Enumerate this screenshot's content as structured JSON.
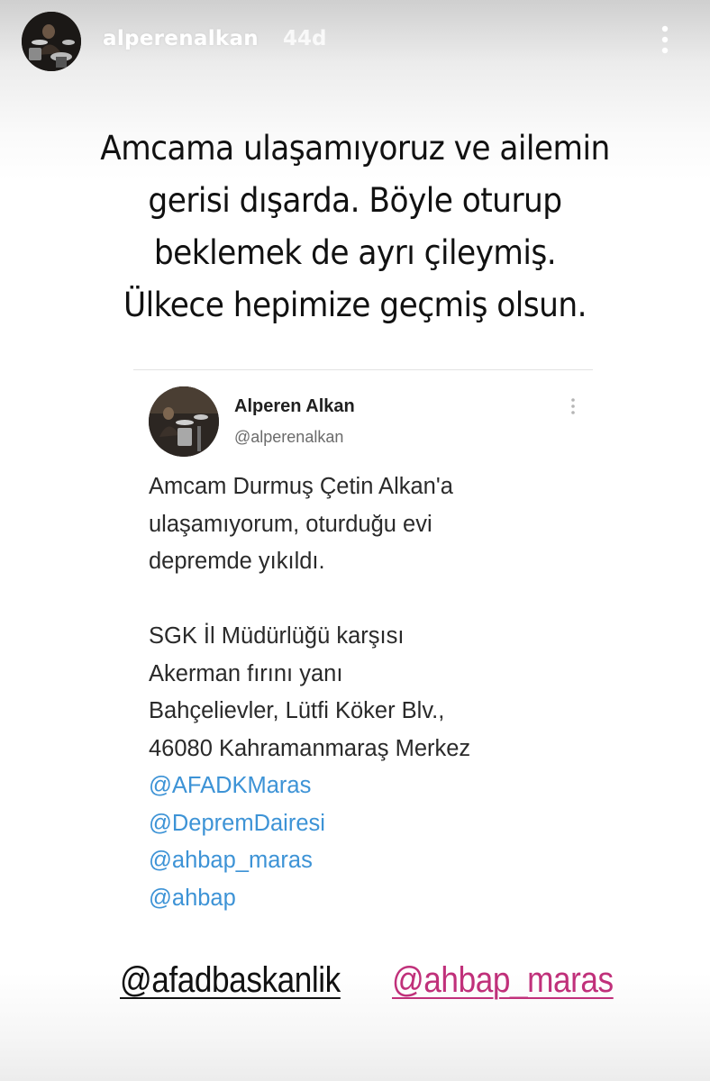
{
  "story": {
    "username": "alperenalkan",
    "time": "44d"
  },
  "caption": {
    "lines": [
      "Amcama ulaşamıyoruz ve ailemin",
      "gerisi dışarda. Böyle oturup",
      "beklemek de ayrı çileymiş.",
      "Ülkece hepimize geçmiş olsun."
    ]
  },
  "tweet": {
    "name": "Alperen Alkan",
    "handle": "@alperenalkan",
    "body_lines": [
      "Amcam Durmuş Çetin Alkan'a",
      "ulaşamıyorum, oturduğu evi",
      "depremde yıkıldı."
    ],
    "address_lines": [
      "SGK İl Müdürlüğü karşısı",
      "Akerman fırını yanı",
      "Bahçelievler, Lütfi Köker Blv.,",
      "46080 Kahramanmaraş Merkez"
    ],
    "mentions": [
      "@AFADKMaras",
      "@DepremDairesi",
      "@ahbap_maras",
      "@ahbap"
    ]
  },
  "stickers": [
    {
      "label": "@afadbaskanlik",
      "color": "#111111"
    },
    {
      "label": "@ahbap_maras",
      "color": "#c0307a"
    }
  ],
  "colors": {
    "mention_link": "#3d93d6",
    "caption_text": "#111111"
  },
  "icons": {
    "story_menu": "more-vertical-icon",
    "tweet_menu": "more-vertical-icon"
  }
}
